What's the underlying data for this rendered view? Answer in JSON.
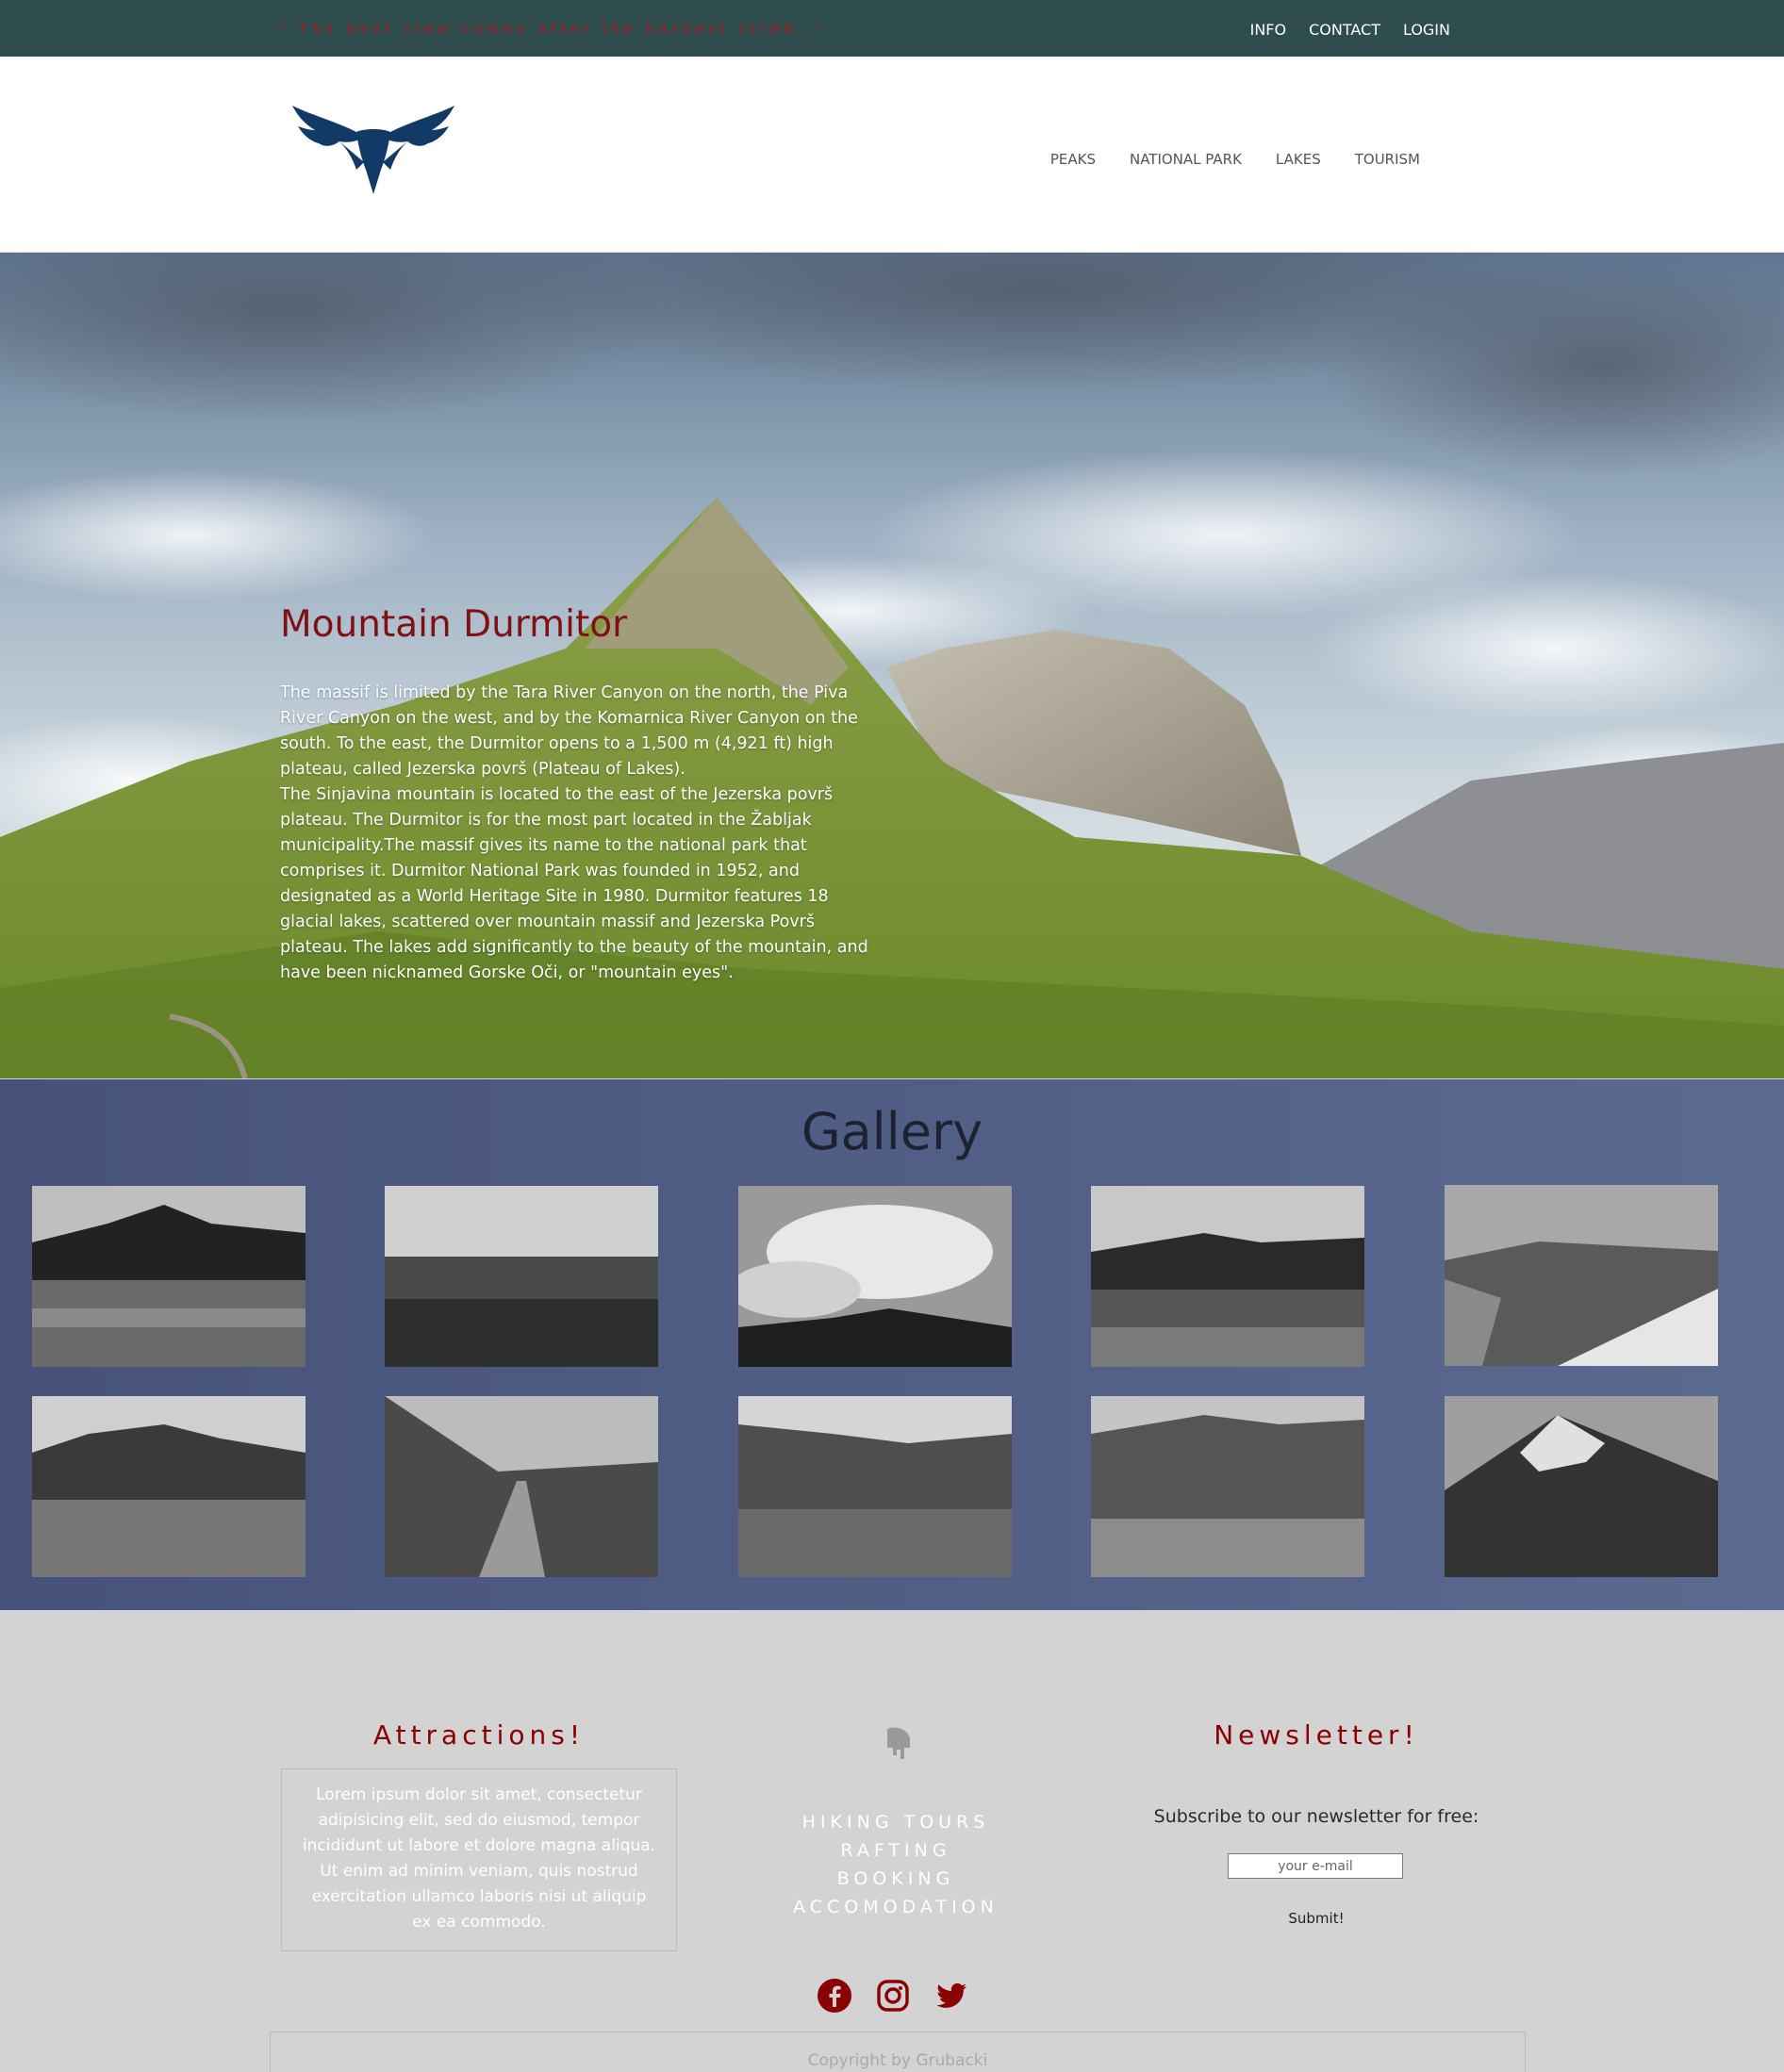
{
  "topbar": {
    "quote": "\" The best view comes after the hardest climb. \"",
    "nav": [
      "INFO",
      "CONTACT",
      "LOGIN"
    ]
  },
  "header": {
    "logo_icon": "eagle-logo",
    "nav": [
      "PEAKS",
      "NATIONAL PARK",
      "LAKES",
      "TOURISM"
    ]
  },
  "hero": {
    "title": "Mountain Durmitor",
    "paragraph1": "The massif is limited by the Tara River Canyon on the north, the Piva River Canyon on the west, and by the Komarnica River Canyon on the south. To the east, the Durmitor opens to a 1,500 m (4,921 ft) high plateau, called Jezerska površ (Plateau of Lakes).",
    "paragraph2": "The Sinjavina mountain is located to the east of the Jezerska površ plateau. The Durmitor is for the most part located in the Žabljak municipality.The massif gives its name to the national park that comprises it. Durmitor National Park was founded in 1952, and designated as a World Heritage Site in 1980. Durmitor features 18 glacial lakes, scattered over mountain massif and Jezerska Površ plateau. The lakes add significantly to the beauty of the mountain, and have been nicknamed Gorske Oči, or \"mountain eyes\"."
  },
  "gallery": {
    "title": "Gallery",
    "thumbnails": [
      "lake-reflection",
      "plain-field",
      "cloudy-sky",
      "forest-lake",
      "rocky-snow-slope",
      "mountain-valley",
      "mountain-road",
      "rocky-plateau",
      "boulder-valley",
      "snowy-peak"
    ]
  },
  "footer": {
    "attractions_title": "Attractions!",
    "attractions_text": "Lorem ipsum dolor sit amet, consectetur adipisicing elit, sed do eiusmod, tempor incididunt ut labore et dolore magna aliqua. Ut enim ad minim veniam, quis nostrud exercitation ullamco laboris nisi ut aliquip ex ea commodo.",
    "links": [
      "HIKING TOURS",
      "RAFTING",
      "BOOKING",
      "ACCOMODATION"
    ],
    "newsletter_title": "Newsletter!",
    "subscribe_label": "Subscribe to our newsletter for free:",
    "email_placeholder": "your e-mail",
    "submit_label": "Submit!",
    "social_icons": [
      "facebook-icon",
      "instagram-icon",
      "twitter-icon"
    ],
    "copyright": "Copyright by Grubacki"
  },
  "colors": {
    "topbar": "#2e4d4c",
    "accent_red": "#8b0000",
    "gallery_bg": "#4f5b82",
    "footer_bg": "#d3d3d3"
  }
}
